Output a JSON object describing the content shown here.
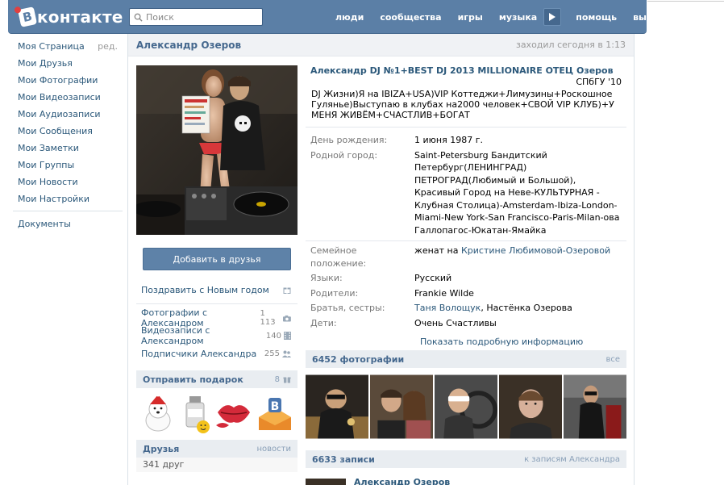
{
  "header": {
    "logo_text": "контакте",
    "logo_letter": "В",
    "search_placeholder": "Поиск",
    "nav": [
      "люди",
      "сообщества",
      "игры",
      "музыка",
      "помощь",
      "выйти"
    ]
  },
  "left_menu": {
    "items": [
      {
        "label": "Моя Страница",
        "extra": "ред."
      },
      {
        "label": "Мои Друзья"
      },
      {
        "label": "Мои Фотографии"
      },
      {
        "label": "Мои Видеозаписи"
      },
      {
        "label": "Мои Аудиозаписи"
      },
      {
        "label": "Мои Сообщения"
      },
      {
        "label": "Мои Заметки"
      },
      {
        "label": "Мои Группы"
      },
      {
        "label": "Мои Новости"
      },
      {
        "label": "Мои Настройки"
      }
    ],
    "extra_item": "Документы"
  },
  "profile": {
    "title_name": "Александр Озеров",
    "last_seen": "заходил сегодня в 1:13",
    "add_friend": "Добавить в друзья",
    "congrats": "Поздравить с Новым годом",
    "links": [
      {
        "label": "Фотографии с Александром",
        "count": "1 113",
        "icon": "camera-icon"
      },
      {
        "label": "Видеозаписи с Александром",
        "count": "140",
        "icon": "film-icon"
      },
      {
        "label": "Подписчики Александра",
        "count": "255",
        "icon": "people-icon"
      }
    ],
    "gift_section": {
      "title": "Отправить подарок",
      "count": "8"
    },
    "friends_section": {
      "title": "Друзья",
      "right": "новости",
      "count": "341 друг"
    },
    "full_name": "Александр DJ №1+BEST DJ 2013 MILLIONAIRE ОТЕЦ Озеров",
    "university": "СПбГУ '10",
    "status": "DJ Жизни)Я на IBIZA+USA)VIP Коттеджи+Лимузины+Роскошное Гулянье)Выступаю в клубах на2000 человек+СВОЙ VIP КЛУБ)+У МЕНЯ ЖИВЁМ+СЧАСТЛИВ+БОГАТ",
    "info": {
      "birthday_label": "День рождения:",
      "birthday": "1 июня 1987 г.",
      "hometown_label": "Родной город:",
      "hometown": "Saint-Petersburg Бандитский Петербург(ЛЕНИНГРАД) ПЕТРОГРАД(Любимый и Большой), Красивый Город на Неве-КУЛЬТУРНАЯ - Клубная Столица)-Amsterdam-Ibiza-London-Miami-New York-San Francisco-Paris-Milan-ова Галлопагос-Юкатан-Ямайка",
      "family_label": "Семейное положение:",
      "family_prefix": "женат на",
      "family_link": "Кристине Любимовой-Озеровой",
      "lang_label": "Языки:",
      "lang": "Русский",
      "parents_label": "Родители:",
      "parents": "Frankie Wilde",
      "siblings_label": "Братья, сестры:",
      "sibling1": "Таня Волощук",
      "sibling_sep": ",",
      "sibling2": "Настёнка Озерова",
      "children_label": "Дети:",
      "children": "Очень Счастливы"
    },
    "show_more": "Показать подробную информацию",
    "photos_section": {
      "title": "6452 фотографии",
      "right": "все"
    },
    "wall_section": {
      "title": "6633 записи",
      "right": "к записям Александра"
    },
    "wall_author": "Александр Озеров"
  }
}
